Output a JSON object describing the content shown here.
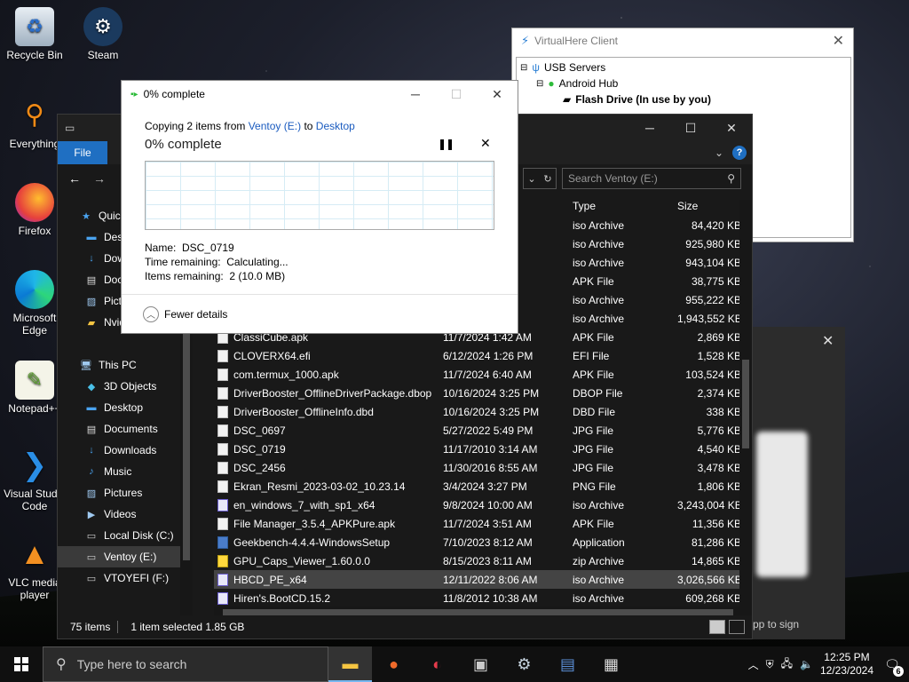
{
  "desktop": {
    "icons": [
      {
        "label": "Recycle Bin",
        "icon": "recycle-bin-icon"
      },
      {
        "label": "Steam",
        "icon": "steam-icon"
      },
      {
        "label": "Everything",
        "icon": "everything-icon"
      },
      {
        "label": "Firefox",
        "icon": "firefox-icon"
      },
      {
        "label": "Microsoft Edge",
        "icon": "edge-icon"
      },
      {
        "label": "Notepad++",
        "icon": "notepadpp-icon"
      },
      {
        "label": "Visual Studio Code",
        "icon": "vscode-icon"
      },
      {
        "label": "VLC media player",
        "icon": "vlc-icon"
      }
    ]
  },
  "virtualhere": {
    "title": "VirtualHere Client",
    "tree": [
      "USB Servers",
      "Android Hub",
      "Flash Drive (In use by you)"
    ]
  },
  "dialog": {
    "title": "0% complete",
    "copy_prefix": "Copying 2 items from",
    "source": "Ventoy (E:)",
    "to": "to",
    "destination": "Desktop",
    "percent_label": "0% complete",
    "progress": 0,
    "name_label": "Name:",
    "name_value": "DSC_0719",
    "time_label": "Time remaining:",
    "time_value": "Calculating...",
    "items_label": "Items remaining:",
    "items_value": "2 (10.0 MB)",
    "fewer_details": "Fewer details"
  },
  "explorer": {
    "file_tab": "File",
    "search_placeholder": "Search Ventoy (E:)",
    "columns": {
      "type": "Type",
      "size": "Size"
    },
    "sidebar": [
      {
        "label": "Quick access",
        "indent": 1
      },
      {
        "label": "Desktop",
        "indent": 2
      },
      {
        "label": "Downloads",
        "indent": 2
      },
      {
        "label": "Documents",
        "indent": 2
      },
      {
        "label": "Pictures",
        "indent": 2
      },
      {
        "label": "Nvidia",
        "indent": 2
      },
      {
        "label": "",
        "indent": 0
      },
      {
        "label": "This PC",
        "indent": 1
      },
      {
        "label": "3D Objects",
        "indent": 2
      },
      {
        "label": "Desktop",
        "indent": 2
      },
      {
        "label": "Documents",
        "indent": 2
      },
      {
        "label": "Downloads",
        "indent": 2
      },
      {
        "label": "Music",
        "indent": 2
      },
      {
        "label": "Pictures",
        "indent": 2
      },
      {
        "label": "Videos",
        "indent": 2
      },
      {
        "label": "Local Disk (C:)",
        "indent": 2
      },
      {
        "label": "Ventoy (E:)",
        "indent": 2
      },
      {
        "label": "VTOYEFI (F:)",
        "indent": 2
      },
      {
        "label": "",
        "indent": 0
      },
      {
        "label": "VTOYEFI (F:)",
        "indent": 1
      }
    ],
    "files": [
      {
        "name": "",
        "date": "AM",
        "type": "iso Archive",
        "size": "84,420 KB",
        "icon": "iso"
      },
      {
        "name": "",
        "date": "AM",
        "type": "iso Archive",
        "size": "925,980 KB",
        "icon": "iso"
      },
      {
        "name": "",
        "date": "AM",
        "type": "iso Archive",
        "size": "943,104 KB",
        "icon": "iso"
      },
      {
        "name": "",
        "date": "AM",
        "type": "APK File",
        "size": "38,775 KB",
        "icon": "doc"
      },
      {
        "name": "",
        "date": "AM",
        "type": "iso Archive",
        "size": "955,222 KB",
        "icon": "iso"
      },
      {
        "name": "",
        "date": "8 AM",
        "type": "iso Archive",
        "size": "1,943,552 KB",
        "icon": "iso"
      },
      {
        "name": "ClassiCube.apk",
        "date": "11/7/2024 1:42 AM",
        "type": "APK File",
        "size": "2,869 KB",
        "icon": "doc"
      },
      {
        "name": "CLOVERX64.efi",
        "date": "6/12/2024 1:26 PM",
        "type": "EFI File",
        "size": "1,528 KB",
        "icon": "doc"
      },
      {
        "name": "com.termux_1000.apk",
        "date": "11/7/2024 6:40 AM",
        "type": "APK File",
        "size": "103,524 KB",
        "icon": "doc"
      },
      {
        "name": "DriverBooster_OfflineDriverPackage.dbop",
        "date": "10/16/2024 3:25 PM",
        "type": "DBOP File",
        "size": "2,374 KB",
        "icon": "doc"
      },
      {
        "name": "DriverBooster_OfflineInfo.dbd",
        "date": "10/16/2024 3:25 PM",
        "type": "DBD File",
        "size": "338 KB",
        "icon": "doc"
      },
      {
        "name": "DSC_0697",
        "date": "5/27/2022 5:49 PM",
        "type": "JPG File",
        "size": "5,776 KB",
        "icon": "doc"
      },
      {
        "name": "DSC_0719",
        "date": "11/17/2010 3:14 AM",
        "type": "JPG File",
        "size": "4,540 KB",
        "icon": "doc"
      },
      {
        "name": "DSC_2456",
        "date": "11/30/2016 8:55 AM",
        "type": "JPG File",
        "size": "3,478 KB",
        "icon": "doc"
      },
      {
        "name": "Ekran_Resmi_2023-03-02_10.23.14",
        "date": "3/4/2024 3:27 PM",
        "type": "PNG File",
        "size": "1,806 KB",
        "icon": "doc"
      },
      {
        "name": "en_windows_7_with_sp1_x64",
        "date": "9/8/2024 10:00 AM",
        "type": "iso Archive",
        "size": "3,243,004 KB",
        "icon": "iso"
      },
      {
        "name": "File Manager_3.5.4_APKPure.apk",
        "date": "11/7/2024 3:51 AM",
        "type": "APK File",
        "size": "11,356 KB",
        "icon": "doc"
      },
      {
        "name": "Geekbench-4.4.4-WindowsSetup",
        "date": "7/10/2023 8:12 AM",
        "type": "Application",
        "size": "81,286 KB",
        "icon": "app"
      },
      {
        "name": "GPU_Caps_Viewer_1.60.0.0",
        "date": "8/15/2023 8:11 AM",
        "type": "zip Archive",
        "size": "14,865 KB",
        "icon": "zip"
      },
      {
        "name": "HBCD_PE_x64",
        "date": "12/11/2022 8:06 AM",
        "type": "iso Archive",
        "size": "3,026,566 KB",
        "icon": "iso",
        "selected": true
      },
      {
        "name": "Hiren's.BootCD.15.2",
        "date": "11/8/2012 10:38 AM",
        "type": "iso Archive",
        "size": "609,268 KB",
        "icon": "iso"
      }
    ],
    "status": {
      "items": "75 items",
      "selected": "1 item selected  1.85 GB"
    }
  },
  "qr_panel": {
    "text": "pp to sign"
  },
  "taskbar": {
    "search_placeholder": "Type here to search",
    "time": "12:25 PM",
    "date": "12/23/2024",
    "notifications": "6"
  }
}
